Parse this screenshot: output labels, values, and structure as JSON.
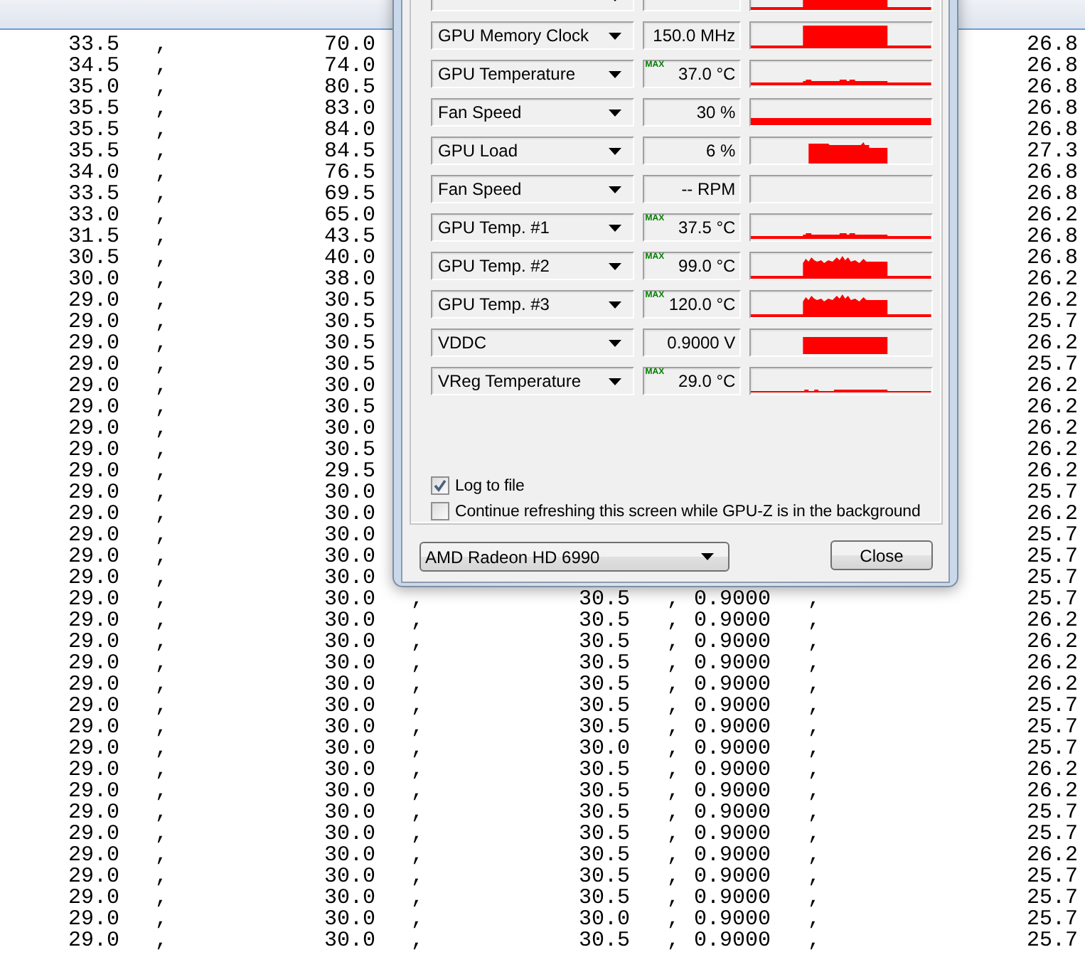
{
  "log": {
    "rows": [
      [
        "33.5",
        ",",
        "70.0",
        null,
        null,
        null,
        null,
        null,
        "26.8"
      ],
      [
        "34.5",
        ",",
        "74.0",
        null,
        null,
        null,
        null,
        null,
        "26.8"
      ],
      [
        "35.0",
        ",",
        "80.5",
        null,
        null,
        null,
        null,
        null,
        "26.8"
      ],
      [
        "35.5",
        ",",
        "83.0",
        null,
        null,
        null,
        null,
        null,
        "26.8"
      ],
      [
        "35.5",
        ",",
        "84.0",
        null,
        null,
        null,
        null,
        null,
        "26.8"
      ],
      [
        "35.5",
        ",",
        "84.5",
        null,
        null,
        null,
        null,
        null,
        "27.3"
      ],
      [
        "34.0",
        ",",
        "76.5",
        null,
        null,
        null,
        null,
        null,
        "26.8"
      ],
      [
        "33.5",
        ",",
        "69.5",
        null,
        null,
        null,
        null,
        null,
        "26.8"
      ],
      [
        "33.0",
        ",",
        "65.0",
        null,
        null,
        null,
        null,
        null,
        "26.2"
      ],
      [
        "31.5",
        ",",
        "43.5",
        null,
        null,
        null,
        null,
        null,
        "26.8"
      ],
      [
        "30.5",
        ",",
        "40.0",
        null,
        null,
        null,
        null,
        null,
        "26.8"
      ],
      [
        "30.0",
        ",",
        "38.0",
        null,
        null,
        null,
        null,
        null,
        "26.2"
      ],
      [
        "29.0",
        ",",
        "30.5",
        null,
        null,
        null,
        null,
        null,
        "26.2"
      ],
      [
        "29.0",
        ",",
        "30.5",
        null,
        null,
        null,
        null,
        null,
        "25.7"
      ],
      [
        "29.0",
        ",",
        "30.5",
        null,
        null,
        null,
        null,
        null,
        "26.2"
      ],
      [
        "29.0",
        ",",
        "30.5",
        null,
        null,
        null,
        null,
        null,
        "25.7"
      ],
      [
        "29.0",
        ",",
        "30.0",
        null,
        null,
        null,
        null,
        null,
        "26.2"
      ],
      [
        "29.0",
        ",",
        "30.5",
        null,
        null,
        null,
        null,
        null,
        "26.2"
      ],
      [
        "29.0",
        ",",
        "30.0",
        null,
        null,
        null,
        null,
        null,
        "26.2"
      ],
      [
        "29.0",
        ",",
        "30.5",
        null,
        null,
        null,
        null,
        null,
        "26.2"
      ],
      [
        "29.0",
        ",",
        "29.5",
        null,
        null,
        null,
        null,
        null,
        "26.2"
      ],
      [
        "29.0",
        ",",
        "30.0",
        null,
        null,
        null,
        null,
        null,
        "25.7"
      ],
      [
        "29.0",
        ",",
        "30.0",
        null,
        null,
        null,
        null,
        null,
        "26.2"
      ],
      [
        "29.0",
        ",",
        "30.0",
        null,
        null,
        null,
        null,
        null,
        "25.7"
      ],
      [
        "29.0",
        ",",
        "30.0",
        null,
        null,
        null,
        null,
        null,
        "25.7"
      ],
      [
        "29.0",
        ",",
        "30.0",
        null,
        null,
        null,
        null,
        null,
        "25.7"
      ],
      [
        "29.0",
        ",",
        "30.0",
        ",",
        "30.5",
        ",",
        "0.9000",
        ",",
        "25.7"
      ],
      [
        "29.0",
        ",",
        "30.0",
        ",",
        "30.5",
        ",",
        "0.9000",
        ",",
        "26.2"
      ],
      [
        "29.0",
        ",",
        "30.0",
        ",",
        "30.5",
        ",",
        "0.9000",
        ",",
        "26.2"
      ],
      [
        "29.0",
        ",",
        "30.0",
        ",",
        "30.5",
        ",",
        "0.9000",
        ",",
        "26.2"
      ],
      [
        "29.0",
        ",",
        "30.0",
        ",",
        "30.5",
        ",",
        "0.9000",
        ",",
        "26.2"
      ],
      [
        "29.0",
        ",",
        "30.0",
        ",",
        "30.5",
        ",",
        "0.9000",
        ",",
        "25.7"
      ],
      [
        "29.0",
        ",",
        "30.0",
        ",",
        "30.5",
        ",",
        "0.9000",
        ",",
        "25.7"
      ],
      [
        "29.0",
        ",",
        "30.0",
        ",",
        "30.0",
        ",",
        "0.9000",
        ",",
        "25.7"
      ],
      [
        "29.0",
        ",",
        "30.0",
        ",",
        "30.5",
        ",",
        "0.9000",
        ",",
        "26.2"
      ],
      [
        "29.0",
        ",",
        "30.0",
        ",",
        "30.5",
        ",",
        "0.9000",
        ",",
        "26.2"
      ],
      [
        "29.0",
        ",",
        "30.0",
        ",",
        "30.5",
        ",",
        "0.9000",
        ",",
        "25.7"
      ],
      [
        "29.0",
        ",",
        "30.0",
        ",",
        "30.5",
        ",",
        "0.9000",
        ",",
        "25.7"
      ],
      [
        "29.0",
        ",",
        "30.0",
        ",",
        "30.5",
        ",",
        "0.9000",
        ",",
        "26.2"
      ],
      [
        "29.0",
        ",",
        "30.0",
        ",",
        "30.5",
        ",",
        "0.9000",
        ",",
        "25.7"
      ],
      [
        "29.0",
        ",",
        "30.0",
        ",",
        "30.5",
        ",",
        "0.9000",
        ",",
        "25.7"
      ],
      [
        "29.0",
        ",",
        "30.0",
        ",",
        "30.0",
        ",",
        "0.9000",
        ",",
        "25.7"
      ],
      [
        "29.0",
        ",",
        "30.0",
        ",",
        "30.5",
        ",",
        "0.9000",
        ",",
        "25.7"
      ]
    ]
  },
  "gpuz": {
    "sensors": [
      {
        "kind": "plateau"
      },
      {
        "label": "GPU Memory Clock",
        "value": "150.0 MHz",
        "kind": "plateau"
      },
      {
        "label": "GPU Temperature",
        "badge": "MAX",
        "value": "37.0 °C",
        "kind": "ripple"
      },
      {
        "label": "Fan Speed",
        "value": "30 %",
        "kind": "band"
      },
      {
        "label": "GPU Load",
        "value": "6 %",
        "kind": "block"
      },
      {
        "label": "Fan Speed",
        "value": "-- RPM",
        "kind": "empty"
      },
      {
        "label": "GPU Temp. #1",
        "badge": "MAX",
        "value": "37.5 °C",
        "kind": "ripple"
      },
      {
        "label": "GPU Temp. #2",
        "badge": "MAX",
        "value": "99.0 °C",
        "kind": "spiky"
      },
      {
        "label": "GPU Temp. #3",
        "badge": "MAX",
        "value": "120.0 °C",
        "kind": "spiky"
      },
      {
        "label": "VDDC",
        "value": "0.9000 V",
        "kind": "slab"
      },
      {
        "label": "VReg Temperature",
        "badge": "MAX",
        "value": "29.0 °C",
        "kind": "flat"
      }
    ],
    "checkboxes": [
      {
        "label": "Log to file",
        "checked": true
      },
      {
        "label": "Continue refreshing this screen while GPU-Z is in the background",
        "checked": false
      }
    ],
    "card_select": {
      "value": "AMD Radeon HD 6990"
    },
    "close_button": "Close"
  }
}
